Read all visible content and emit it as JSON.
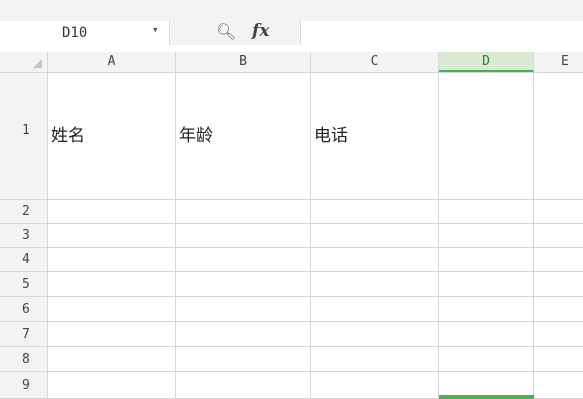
{
  "name_box": {
    "cell_ref": "D10"
  },
  "formula_bar": {
    "fx_label": "fx",
    "value": ""
  },
  "columns": [
    "A",
    "B",
    "C",
    "D",
    "E"
  ],
  "selected_column": "D",
  "rows": [
    {
      "num": "1",
      "cells": [
        "姓名",
        "年龄",
        "电话",
        "",
        ""
      ]
    },
    {
      "num": "2",
      "cells": [
        "",
        "",
        "",
        "",
        ""
      ]
    },
    {
      "num": "3",
      "cells": [
        "",
        "",
        "",
        "",
        ""
      ]
    },
    {
      "num": "4",
      "cells": [
        "",
        "",
        "",
        "",
        ""
      ]
    },
    {
      "num": "5",
      "cells": [
        "",
        "",
        "",
        "",
        ""
      ]
    },
    {
      "num": "6",
      "cells": [
        "",
        "",
        "",
        "",
        ""
      ]
    },
    {
      "num": "7",
      "cells": [
        "",
        "",
        "",
        "",
        ""
      ]
    },
    {
      "num": "8",
      "cells": [
        "",
        "",
        "",
        "",
        ""
      ]
    },
    {
      "num": "9",
      "cells": [
        "",
        "",
        "",
        "",
        ""
      ]
    }
  ],
  "colors": {
    "selection": "#4caf50",
    "selected_header_bg": "#d9ead3"
  }
}
